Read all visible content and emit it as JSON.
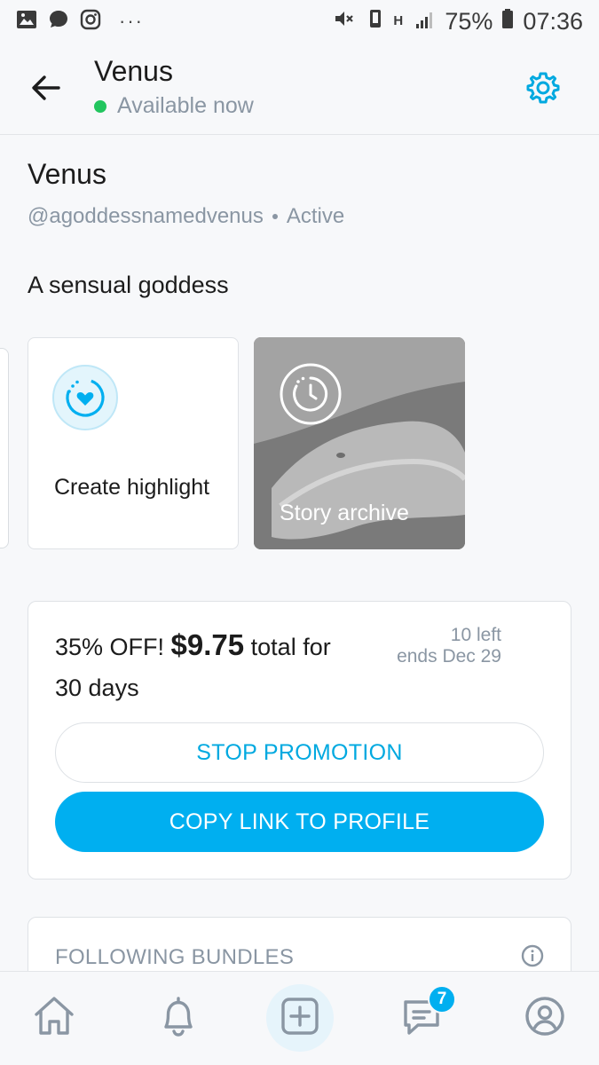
{
  "status_bar": {
    "battery": "75%",
    "time": "07:36",
    "network": "H",
    "more": "···"
  },
  "header": {
    "title": "Venus",
    "status": "Available now"
  },
  "profile": {
    "name": "Venus",
    "handle": "@agoddessnamedvenus",
    "activity": "Active",
    "bio": "A sensual goddess"
  },
  "highlights": {
    "create_label": "Create highlight",
    "archive_label": "Story archive"
  },
  "promotion": {
    "discount": "35% OFF!",
    "price": "$9.75",
    "total_for": "total for",
    "duration": "30 days",
    "left": "10 left",
    "ends": "ends Dec 29",
    "stop_label": "STOP PROMOTION",
    "copy_label": "COPY LINK TO PROFILE"
  },
  "bundles": {
    "title": "FOLLOWING BUNDLES"
  },
  "nav": {
    "messages_badge": "7",
    "items": [
      "home-icon",
      "bell-icon",
      "plus-square-icon",
      "chat-icon",
      "profile-icon"
    ]
  },
  "colors": {
    "accent": "#00aff0",
    "accent_text": "#00a9e0",
    "online": "#22c55e",
    "muted": "#8a96a3"
  }
}
